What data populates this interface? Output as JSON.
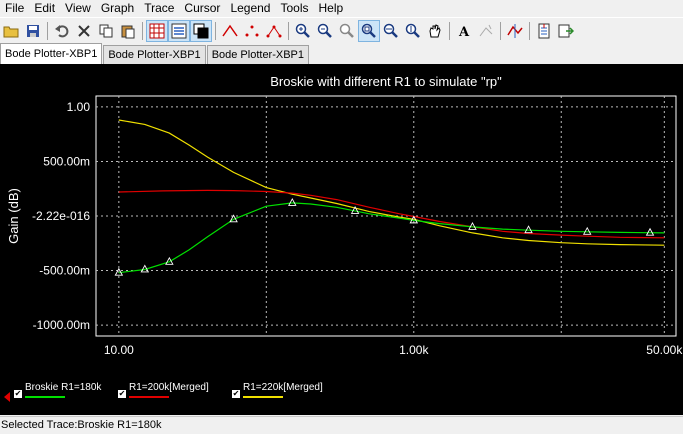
{
  "menu": {
    "items": [
      "File",
      "Edit",
      "View",
      "Graph",
      "Trace",
      "Cursor",
      "Legend",
      "Tools",
      "Help"
    ]
  },
  "toolbar": {
    "icons": [
      "open-folder-icon",
      "save-icon",
      "undo-icon",
      "delete-icon",
      "copy-icon",
      "paste-icon",
      "grid-icon",
      "legend-icon",
      "overlay-icon",
      "line-trace-icon",
      "points-icon",
      "line-points-icon",
      "zoom-in-icon",
      "zoom-out-icon",
      "zoom-area-icon",
      "zoom-fit-icon",
      "zoom-x-icon",
      "zoom-y-icon",
      "pan-hand-icon",
      "text-label-icon",
      "cursor-icon",
      "show-cursors-icon",
      "export-icon",
      "transfer-icon"
    ]
  },
  "tabs": [
    {
      "label": "Bode Plotter-XBP1",
      "active": true
    },
    {
      "label": "Bode Plotter-XBP1",
      "active": false
    },
    {
      "label": "Bode Plotter-XBP1",
      "active": false
    }
  ],
  "chart_data": {
    "type": "line",
    "title": "Broskie with different R1 to simulate \"rp\"",
    "ylabel": "Gain (dB)",
    "xlabel": "",
    "xscale": "log",
    "xlim": [
      7,
      60000
    ],
    "ylim": [
      -1100,
      1100
    ],
    "grid": true,
    "x_tick_labels": [
      {
        "value": 10,
        "label": "10.00"
      },
      {
        "value": 1000,
        "label": "1.00k"
      },
      {
        "value": 50000,
        "label": "50.00k"
      }
    ],
    "x_grid": [
      100,
      10000
    ],
    "y_tick_labels": [
      {
        "value": 1000,
        "label": "1.00"
      },
      {
        "value": 500,
        "label": "500.00m"
      },
      {
        "value": 0,
        "label": "-2.22e-016"
      },
      {
        "value": -500,
        "label": "-500.00m"
      },
      {
        "value": -1000,
        "label": "-1000.00m"
      }
    ],
    "series": [
      {
        "name": "Broskie R1=180k",
        "color": "#00e000",
        "markers": true,
        "x": [
          10,
          15,
          22,
          30,
          40,
          60,
          100,
          150,
          200,
          300,
          500,
          800,
          1000,
          1500,
          2500,
          4000,
          6000,
          10000,
          15000,
          25000,
          50000
        ],
        "y": [
          -520,
          -490,
          -420,
          -310,
          -190,
          -30,
          90,
          120,
          110,
          80,
          20,
          -20,
          -40,
          -70,
          -100,
          -120,
          -130,
          -140,
          -145,
          -150,
          -155
        ]
      },
      {
        "name": "R1=200k[Merged]",
        "color": "#e00000",
        "markers": false,
        "x": [
          10,
          20,
          40,
          60,
          100,
          150,
          200,
          300,
          500,
          800,
          1000,
          1500,
          2500,
          4000,
          6000,
          10000,
          15000,
          25000,
          50000
        ],
        "y": [
          220,
          230,
          235,
          233,
          225,
          210,
          190,
          150,
          80,
          20,
          -5,
          -50,
          -100,
          -140,
          -160,
          -175,
          -185,
          -195,
          -200
        ]
      },
      {
        "name": "R1=220k[Merged]",
        "color": "#f0e000",
        "markers": false,
        "x": [
          10,
          15,
          22,
          30,
          40,
          60,
          100,
          150,
          200,
          300,
          500,
          800,
          1000,
          1500,
          2500,
          4000,
          6000,
          10000,
          15000,
          25000,
          50000
        ],
        "y": [
          880,
          840,
          760,
          650,
          540,
          400,
          260,
          200,
          165,
          115,
          40,
          -10,
          -30,
          -90,
          -155,
          -200,
          -225,
          -245,
          -255,
          -262,
          -268
        ]
      }
    ],
    "legend_placement": "bottom"
  },
  "status": {
    "text": "Selected Trace:Broskie R1=180k"
  }
}
